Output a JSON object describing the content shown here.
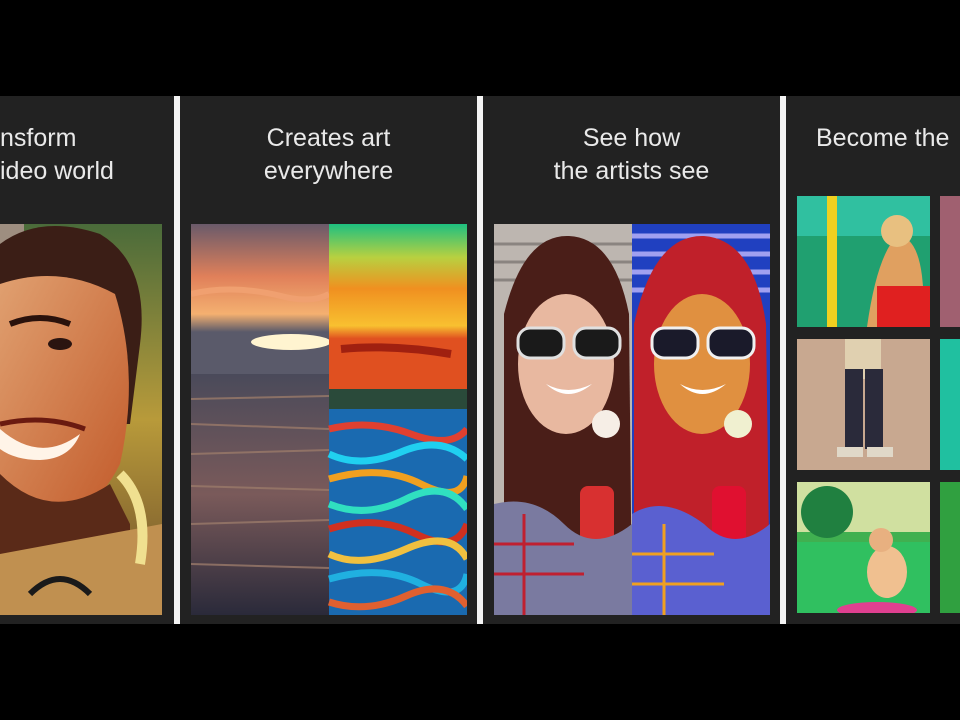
{
  "panels": [
    {
      "id": "transform",
      "caption_line1": "nsform",
      "caption_line2": "ideo world"
    },
    {
      "id": "creates",
      "caption_line1": "Creates art",
      "caption_line2": "everywhere"
    },
    {
      "id": "see",
      "caption_line1": "See how",
      "caption_line2": "the artists see"
    },
    {
      "id": "become",
      "caption_line1": "Become the",
      "caption_line2": ""
    }
  ],
  "colors": {
    "background": "#000000",
    "panel": "#222222",
    "divider": "#f4f4f4",
    "caption": "#e9e9e9"
  },
  "icons": []
}
